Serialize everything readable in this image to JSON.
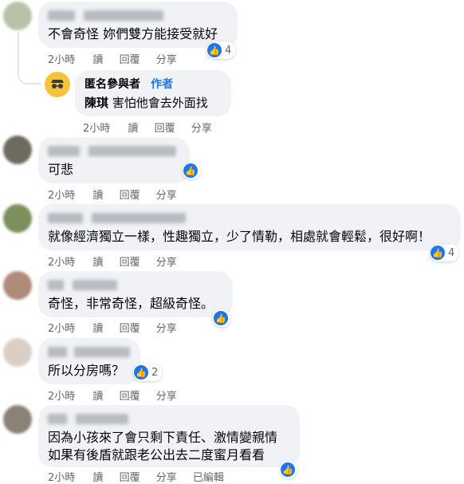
{
  "colors": {
    "like_blue": "#1877f2",
    "bubble_bg": "#f0f2f5",
    "meta_gray": "#65676b",
    "author_tag": "#1877f2"
  },
  "actions": {
    "read": "讀",
    "reply": "回覆",
    "share": "分享",
    "edited": "已編輯"
  },
  "comments": [
    {
      "text": "不會奇怪 妳們雙方能接受就好",
      "time": "2小時",
      "likes": "4"
    },
    {
      "author": "匿名參與者",
      "author_tag": "作者",
      "mention": "陳琪",
      "text": "害怕他會去外面找",
      "time": "2小時"
    },
    {
      "text": "可悲",
      "time": "2小時"
    },
    {
      "text": "就像經濟獨立一樣，性趣獨立，少了情勒，相處就會輕鬆，很好啊！",
      "time": "2小時",
      "likes": "4"
    },
    {
      "text": "奇怪，非常奇怪，超級奇怪。",
      "time": "2小時"
    },
    {
      "text": "所以分房嗎？",
      "time": "2小時",
      "likes": "2"
    },
    {
      "text_line1": "因為小孩來了會只剩下責任、激情變親情",
      "text_line2": "如果有後盾就跟老公出去二度蜜月看看",
      "time": "2小時"
    }
  ],
  "icons": {
    "like": "thumbs-up-icon",
    "anon": "anonymous-glasses-icon"
  }
}
